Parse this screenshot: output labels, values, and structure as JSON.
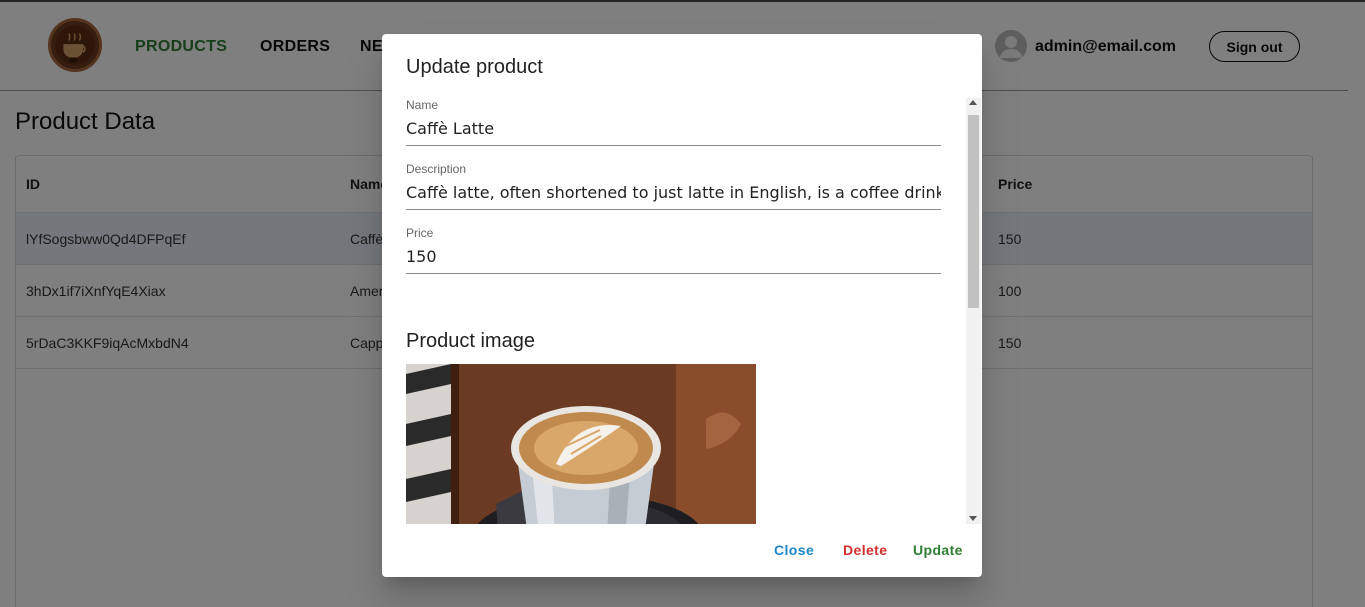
{
  "nav": {
    "links": [
      "PRODUCTS",
      "ORDERS",
      "NE"
    ],
    "user_email": "admin@email.com",
    "signout_label": "Sign out"
  },
  "page": {
    "title": "Product Data",
    "columns": [
      "ID",
      "Name",
      "Price"
    ],
    "rows": [
      {
        "id": "lYfSogsbww0Qd4DFPqEf",
        "name": "Caffè",
        "price": "150"
      },
      {
        "id": "3hDx1if7iXnfYqE4Xiax",
        "name": "Amer",
        "price": "100"
      },
      {
        "id": "5rDaC3KKF9iqAcMxbdN4",
        "name": "Capp",
        "price": "150"
      }
    ]
  },
  "modal": {
    "title": "Update product",
    "name_label": "Name",
    "name_value": "Caffè Latte",
    "description_label": "Description",
    "description_value": "Caffè latte, often shortened to just latte in English, is a coffee drink of Italia",
    "price_label": "Price",
    "price_value": "150",
    "image_heading": "Product image",
    "close_label": "Close",
    "delete_label": "Delete",
    "update_label": "Update"
  },
  "colors": {
    "accent_green": "#2e7d32",
    "close_blue": "#1e88c8",
    "delete_red": "#d32f2f"
  }
}
